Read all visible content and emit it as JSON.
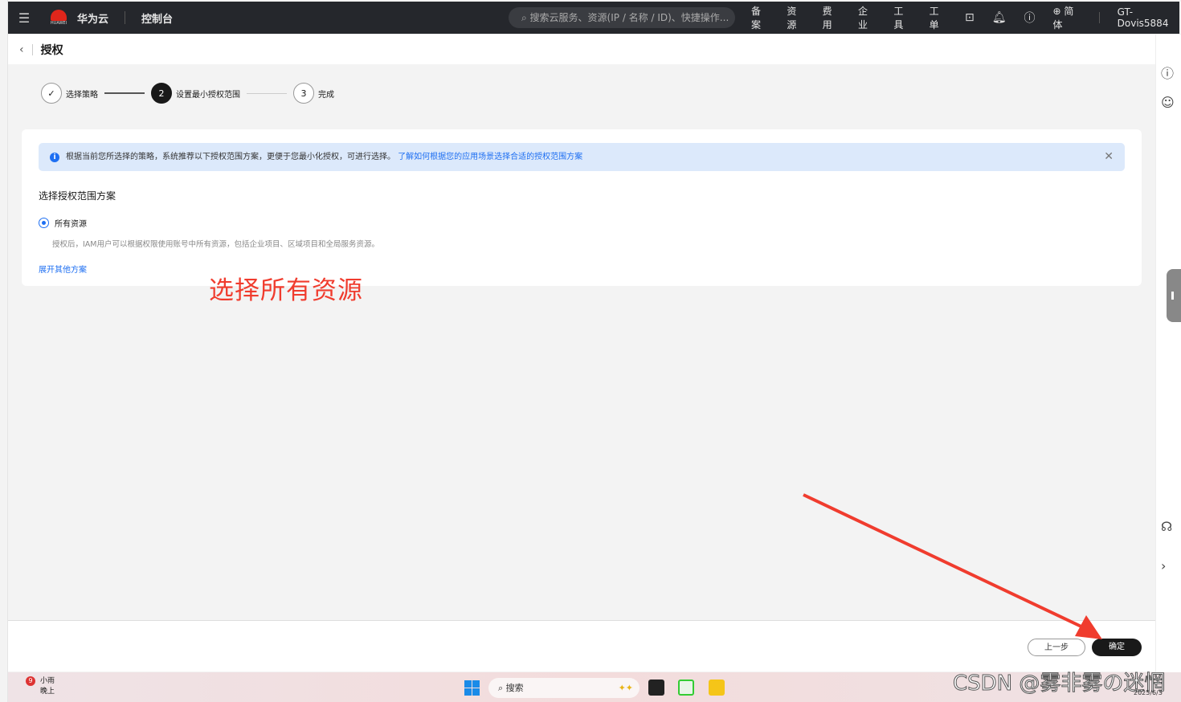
{
  "header": {
    "brand": "华为云",
    "logo_text": "HUAWEI",
    "console": "控制台",
    "search_placeholder": "搜索云服务、资源(IP / 名称 / ID)、快捷操作...",
    "nav": [
      "备案",
      "资源",
      "费用",
      "企业",
      "工具",
      "工单"
    ],
    "language": "简体",
    "user": "GT-Dovis5884"
  },
  "page": {
    "title": "授权"
  },
  "steps": [
    {
      "label": "选择策略",
      "state": "done"
    },
    {
      "num": "2",
      "label": "设置最小授权范围",
      "state": "active"
    },
    {
      "num": "3",
      "label": "完成",
      "state": "pending"
    }
  ],
  "alert": {
    "text": "根据当前您所选择的策略，系统推荐以下授权范围方案，更便于您最小化授权，可进行选择。",
    "link": "了解如何根据您的应用场景选择合适的授权范围方案"
  },
  "section": {
    "title": "选择授权范围方案",
    "option": "所有资源",
    "option_selected": true,
    "option_desc": "授权后，IAM用户可以根据权限使用账号中所有资源，包括企业项目、区域项目和全局服务资源。",
    "expand": "展开其他方案"
  },
  "annotation": "选择所有资源",
  "footer": {
    "prev": "上一步",
    "confirm": "确定"
  },
  "taskbar": {
    "weather_badge": "9",
    "weather": "小雨",
    "weather_sub": "晚上",
    "search": "搜索",
    "date": "2025/6/3"
  },
  "watermark": "CSDN @雾非雾の迷惘",
  "colors": {
    "accent": "#1e6ff2",
    "annotation": "#f03c2e",
    "topbar": "#25272c"
  }
}
